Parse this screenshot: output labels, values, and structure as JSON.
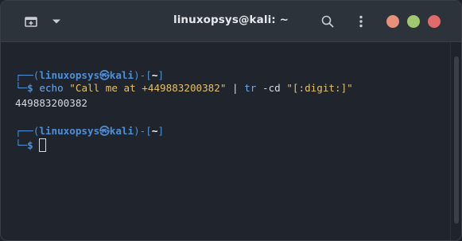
{
  "window": {
    "title": "linuxopsys@kali: ~",
    "icons": [
      "new-tab-icon",
      "chevron-down-icon",
      "search-icon",
      "kebab-menu-icon"
    ],
    "controls": [
      {
        "name": "minimize",
        "color": "#e8917a"
      },
      {
        "name": "maximize",
        "color": "#9fc86f"
      },
      {
        "name": "close",
        "color": "#e36a6a"
      }
    ]
  },
  "terminal": {
    "prompt1": {
      "box_top": "┌──(",
      "user": "linuxopsys㉿kali",
      "mid": ")-[",
      "path": "~",
      "close": "]",
      "box_bottom": "└─",
      "dollar": "$"
    },
    "command": {
      "name": "echo",
      "arg1": "\"Call me at +449883200382\"",
      "pipe": "|",
      "cmd2": "tr",
      "flag": "-cd",
      "arg2": "\"[:digit:]\""
    },
    "output": "449883200382",
    "prompt2": {
      "box_top": "┌──(",
      "user": "linuxopsys㉿kali",
      "mid": ")-[",
      "path": "~",
      "close": "]",
      "box_bottom": "└─",
      "dollar": "$"
    }
  },
  "colors": {
    "background": "#20252d",
    "titlebar": "#2d333b",
    "prompt_blue": "#4f8fd6",
    "string_yellow": "#e3c06c"
  }
}
